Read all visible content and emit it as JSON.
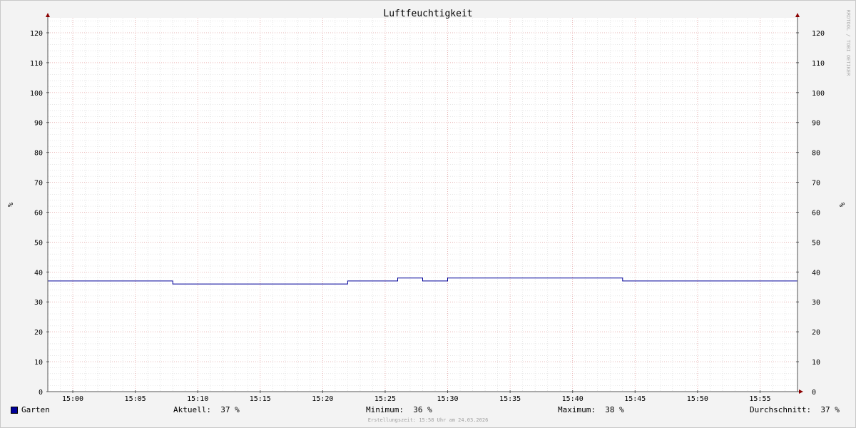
{
  "chart_data": {
    "type": "line",
    "title": "Luftfeuchtigkeit",
    "ylabel": "%",
    "ylabel_right": "%",
    "ylim": [
      0,
      125
    ],
    "yticks": [
      0,
      10,
      20,
      30,
      40,
      50,
      60,
      70,
      80,
      90,
      100,
      110,
      120
    ],
    "xticks": [
      "15:00",
      "15:05",
      "15:10",
      "15:15",
      "15:20",
      "15:25",
      "15:30",
      "15:35",
      "15:40",
      "15:45",
      "15:50",
      "15:55"
    ],
    "xlim": [
      "14:58",
      "15:58"
    ],
    "grid": true,
    "series": [
      {
        "name": "Garten",
        "color": "#000099",
        "points": [
          [
            "14:58",
            37
          ],
          [
            "15:08",
            37
          ],
          [
            "15:08",
            36
          ],
          [
            "15:22",
            36
          ],
          [
            "15:22",
            37
          ],
          [
            "15:26",
            37
          ],
          [
            "15:26",
            38
          ],
          [
            "15:28",
            38
          ],
          [
            "15:28",
            37
          ],
          [
            "15:30",
            37
          ],
          [
            "15:30",
            38
          ],
          [
            "15:44",
            38
          ],
          [
            "15:44",
            37
          ],
          [
            "15:58",
            37
          ]
        ]
      }
    ],
    "watermark": "RRDTOOL / TOBI OETIKER"
  },
  "legend": {
    "series_name": "Garten",
    "current": "Aktuell:  37 %",
    "minimum": "Minimum:  36 %",
    "maximum": "Maximum:  38 %",
    "average": "Durchschnitt:  37 %"
  },
  "footer": "Erstellungszeit: 15:58 Uhr am 24.03.2026"
}
